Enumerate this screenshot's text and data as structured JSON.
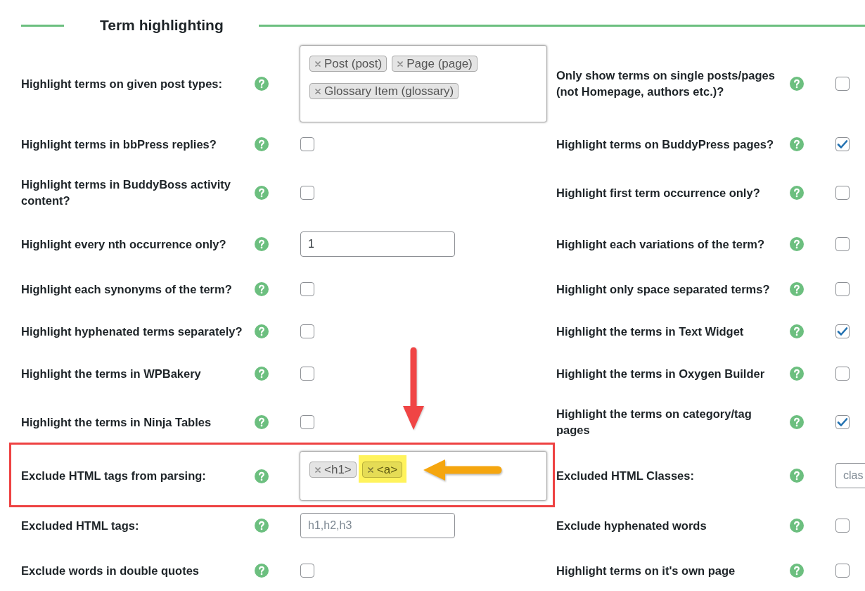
{
  "section": {
    "title": "Term highlighting"
  },
  "rows": [
    {
      "left": {
        "label": "Highlight terms on given post types:",
        "kind": "multiselect",
        "outlined": false,
        "tags": [
          {
            "label": "Post (post)",
            "highlighted": false
          },
          {
            "label": "Page (page)",
            "highlighted": false
          },
          {
            "label": "Glossary Item (glossary)",
            "highlighted": false
          }
        ]
      },
      "right": {
        "label": "Only show terms on single posts/pages (not Homepage, authors etc.)?",
        "kind": "checkbox",
        "checked": false,
        "outlined": false
      }
    },
    {
      "left": {
        "label": "Highlight terms in bbPress replies?",
        "kind": "checkbox",
        "checked": false,
        "outlined": false
      },
      "right": {
        "label": "Highlight terms on BuddyPress pages?",
        "kind": "checkbox",
        "checked": true,
        "outlined": false
      }
    },
    {
      "left": {
        "label": "Highlight terms in BuddyBoss activity content?",
        "kind": "checkbox",
        "checked": false,
        "outlined": false
      },
      "right": {
        "label": "Highlight first term occurrence only?",
        "kind": "checkbox",
        "checked": false,
        "outlined": false
      }
    },
    {
      "left": {
        "label": "Highlight every nth occurrence only?",
        "kind": "text",
        "value": "1",
        "outlined": false
      },
      "right": {
        "label": "Highlight each variations of the term?",
        "kind": "checkbox",
        "checked": false,
        "outlined": false
      }
    },
    {
      "left": {
        "label": "Highlight each synonyms of the term?",
        "kind": "checkbox",
        "checked": false,
        "outlined": false
      },
      "right": {
        "label": "Highlight only space separated terms?",
        "kind": "checkbox",
        "checked": false,
        "outlined": false
      }
    },
    {
      "left": {
        "label": "Highlight hyphenated terms separately?",
        "kind": "checkbox",
        "checked": false,
        "outlined": false
      },
      "right": {
        "label": "Highlight the terms in Text Widget",
        "kind": "checkbox",
        "checked": true,
        "outlined": false
      }
    },
    {
      "left": {
        "label": "Highlight the terms in WPBakery",
        "kind": "checkbox",
        "checked": false,
        "outlined": false
      },
      "right": {
        "label": "Highlight the terms in Oxygen Builder",
        "kind": "checkbox",
        "checked": false,
        "outlined": false
      }
    },
    {
      "left": {
        "label": "Highlight the terms in Ninja Tables",
        "kind": "checkbox",
        "checked": false,
        "outlined": false
      },
      "right": {
        "label": "Highlight the terms on category/tag pages",
        "kind": "checkbox",
        "checked": true,
        "outlined": false
      }
    },
    {
      "left": {
        "label": "Exclude HTML tags from parsing:",
        "kind": "multiselect",
        "outlined": true,
        "tags": [
          {
            "label": "<h1>",
            "highlighted": false
          },
          {
            "label": "<a>",
            "highlighted": true
          }
        ]
      },
      "right": {
        "label": "Excluded HTML Classes:",
        "kind": "text",
        "placeholder": "clas",
        "outlined": false
      }
    },
    {
      "left": {
        "label": "Excluded HTML tags:",
        "kind": "text",
        "placeholder": "h1,h2,h3",
        "outlined": false
      },
      "right": {
        "label": "Exclude hyphenated words",
        "kind": "checkbox",
        "checked": false,
        "outlined": false
      }
    },
    {
      "left": {
        "label": "Exclude words in double quotes",
        "kind": "checkbox",
        "checked": false,
        "outlined": false
      },
      "right": {
        "label": "Highlight terms on it's own page",
        "kind": "checkbox",
        "checked": false,
        "outlined": false
      }
    }
  ]
}
